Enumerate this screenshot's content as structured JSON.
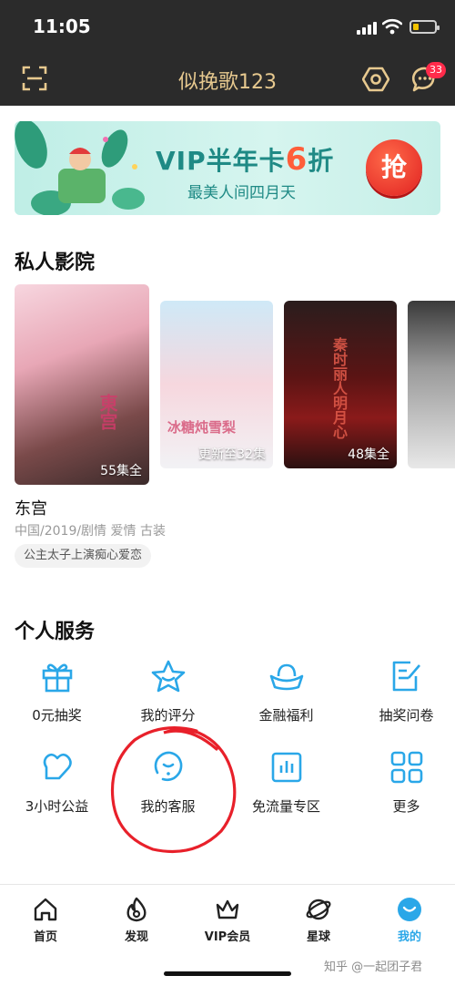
{
  "status": {
    "time": "11:05"
  },
  "header": {
    "title": "似挽歌123",
    "message_count": "33"
  },
  "banner": {
    "title_prefix": "VIP半年卡",
    "title_number": "6",
    "title_suffix": "折",
    "subtitle": "最美人间四月天",
    "button_label": "抢"
  },
  "theater": {
    "title": "私人影院",
    "posters": [
      {
        "episodes": "55集全",
        "overlay_title": "東宫"
      },
      {
        "episodes": "更新至32集",
        "overlay_title": "冰糖炖雪梨"
      },
      {
        "episodes": "48集全",
        "overlay_title": "秦时丽人明月心"
      },
      {
        "episodes": "",
        "overlay_title": ""
      }
    ],
    "featured": {
      "name": "东宫",
      "meta": "中国/2019/剧情 爱情 古装",
      "tag": "公主太子上演痴心爱恋"
    }
  },
  "services": {
    "title": "个人服务",
    "items": [
      {
        "label": "0元抽奖",
        "icon": "gift-icon"
      },
      {
        "label": "我的评分",
        "icon": "star-icon"
      },
      {
        "label": "金融福利",
        "icon": "gold-ingot-icon"
      },
      {
        "label": "抽奖问卷",
        "icon": "survey-icon"
      },
      {
        "label": "3小时公益",
        "icon": "heart-icon"
      },
      {
        "label": "我的客服",
        "icon": "customer-service-icon"
      },
      {
        "label": "免流量专区",
        "icon": "data-chart-icon"
      },
      {
        "label": "更多",
        "icon": "grid-icon"
      }
    ]
  },
  "tabbar": {
    "items": [
      {
        "label": "首页",
        "icon": "home-icon"
      },
      {
        "label": "发现",
        "icon": "fire-icon"
      },
      {
        "label": "VIP会员",
        "icon": "crown-icon"
      },
      {
        "label": "星球",
        "icon": "planet-icon"
      },
      {
        "label": "我的",
        "icon": "profile-icon",
        "active": true
      }
    ]
  },
  "watermark": "知乎 @一起团子君",
  "colors": {
    "accent": "#2aa7e8",
    "header_bg": "#2b2b2b",
    "title_gold": "#e7c98f",
    "badge": "#ff2b4a",
    "annotation": "#e8202a"
  }
}
